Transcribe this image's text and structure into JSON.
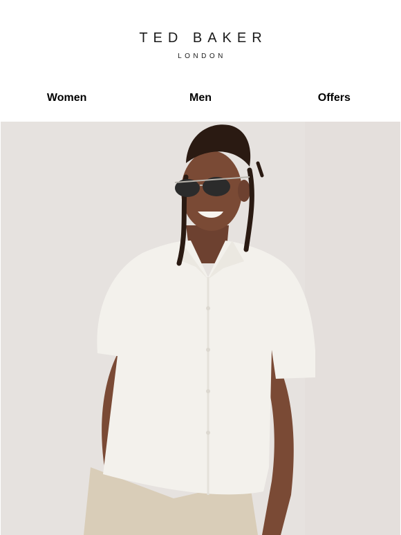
{
  "brand": {
    "name": "TED BAKER",
    "location": "LONDON"
  },
  "nav": {
    "items": [
      {
        "label": "Women"
      },
      {
        "label": "Men"
      },
      {
        "label": "Offers"
      }
    ]
  },
  "hero": {
    "background_color": "#e6e2df",
    "shirt_color": "#f3f1ec",
    "trousers_color": "#d9cdb8",
    "skin_color": "#7a4a35"
  }
}
